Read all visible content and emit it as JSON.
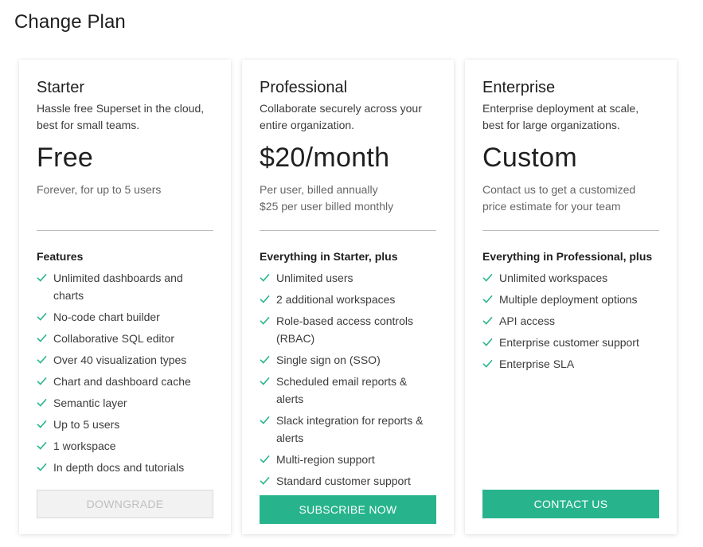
{
  "page": {
    "title": "Change Plan"
  },
  "colors": {
    "accent": "#27b48c",
    "check": "#27b48c",
    "disabled_bg": "#f2f2f2",
    "disabled_text": "#bfbfbf"
  },
  "plans": [
    {
      "name": "Starter",
      "description": "Hassle free Superset in the cloud, best for small teams.",
      "price": "Free",
      "price_note_lines": [
        "Forever, for up to 5 users"
      ],
      "features_heading": "Features",
      "features": [
        "Unlimited dashboards and charts",
        "No-code chart builder",
        "Collaborative SQL editor",
        "Over 40 visualization types",
        "Chart and dashboard cache",
        "Semantic layer",
        "Up to 5 users",
        "1 workspace",
        "In depth docs and tutorials"
      ],
      "button_label": "DOWNGRADE",
      "button_state": "disabled"
    },
    {
      "name": "Professional",
      "description": "Collaborate securely across your entire organization.",
      "price": "$20/month",
      "price_note_lines": [
        "Per user, billed annually",
        "$25 per user billed monthly"
      ],
      "features_heading": "Everything in Starter, plus",
      "features": [
        "Unlimited users",
        "2 additional workspaces",
        "Role-based access controls (RBAC)",
        "Single sign on (SSO)",
        "Scheduled email reports & alerts",
        "Slack integration for reports & alerts",
        "Multi-region support",
        "Standard customer support"
      ],
      "button_label": "SUBSCRIBE NOW",
      "button_state": "primary"
    },
    {
      "name": "Enterprise",
      "description": "Enterprise deployment at scale, best for large organizations.",
      "price": "Custom",
      "price_note_lines": [
        "Contact us to get a customized",
        "price estimate for your team"
      ],
      "features_heading": "Everything in Professional, plus",
      "features": [
        "Unlimited workspaces",
        "Multiple deployment options",
        "API access",
        "Enterprise customer support",
        "Enterprise SLA"
      ],
      "button_label": "CONTACT US",
      "button_state": "primary"
    }
  ]
}
